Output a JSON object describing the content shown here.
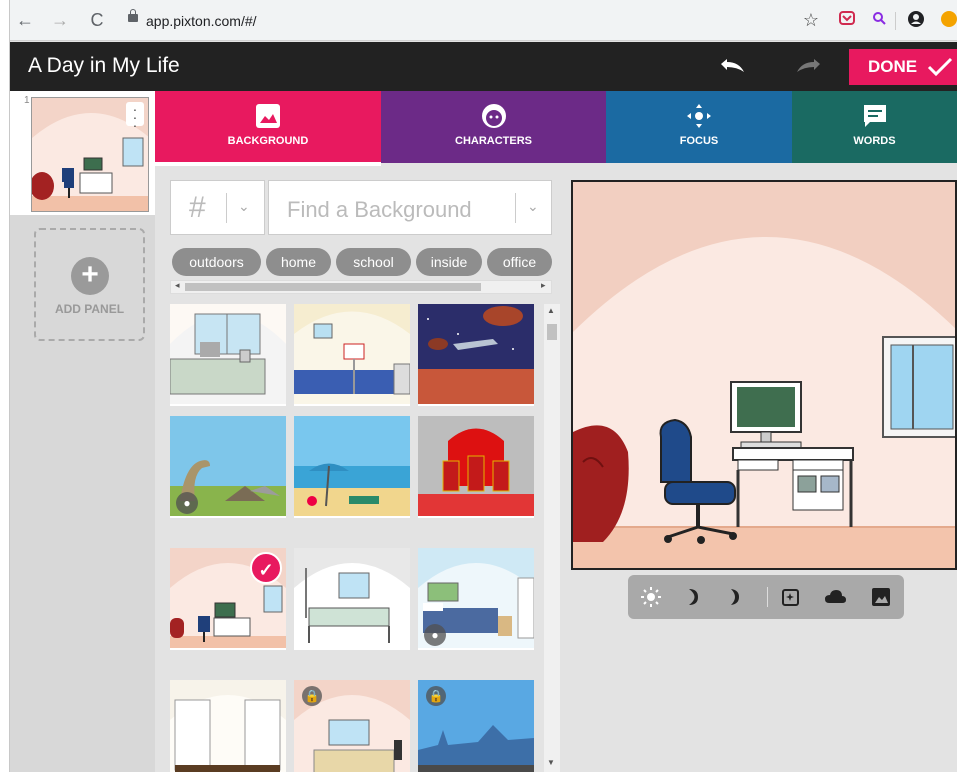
{
  "browser": {
    "back": "←",
    "forward": "→",
    "reload": "C",
    "url": "app.pixton.com/#/",
    "star": "☆"
  },
  "app": {
    "title": "A Day in My Life",
    "done_label": "DONE"
  },
  "panels": {
    "items": [
      {
        "number": "1"
      }
    ],
    "add_label": "ADD PANEL"
  },
  "tabs": [
    {
      "label": "BACKGROUND",
      "icon": "image-icon",
      "color": "#e8195f"
    },
    {
      "label": "CHARACTERS",
      "icon": "face-icon",
      "color": "#6c2a87"
    },
    {
      "label": "FOCUS",
      "icon": "move-icon",
      "color": "#1b6aa2"
    },
    {
      "label": "WORDS",
      "icon": "speech-icon",
      "color": "#1a6a62"
    }
  ],
  "search": {
    "hash": "#",
    "placeholder": "Find a Background"
  },
  "chips": [
    "outdoors",
    "home",
    "school",
    "inside",
    "office"
  ],
  "stage_toolbar": [
    "sun-icon",
    "moon-half-icon",
    "moon-crescent-icon",
    "sparkle-frame-icon",
    "cloud-icon",
    "image-icon"
  ]
}
